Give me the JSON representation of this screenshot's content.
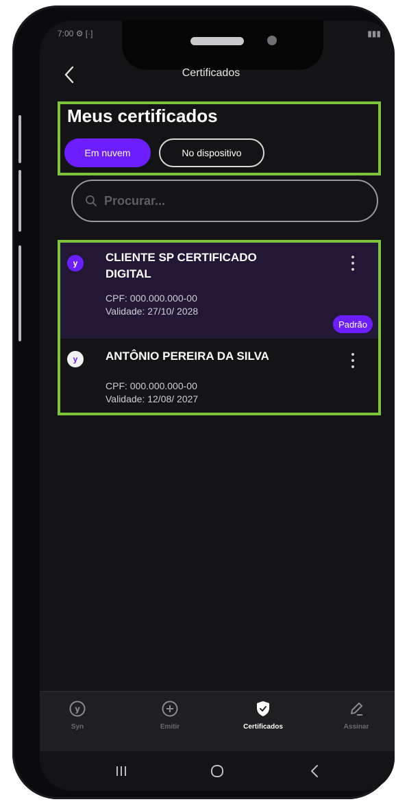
{
  "status_bar": {
    "left": "7:00 ⚙ [·]",
    "right": "▮▮▮"
  },
  "header": {
    "title": "Certificados"
  },
  "section": {
    "title": "Meus certificados",
    "chips": [
      {
        "label": "Em nuvem",
        "active": true
      },
      {
        "label": "No dispositivo",
        "active": false
      }
    ]
  },
  "search": {
    "placeholder": "Procurar..."
  },
  "certificates": [
    {
      "name": "CLIENTE SP CERTIFICADO DIGITAL",
      "cpf": "CPF: 000.000.000-00",
      "validity": "Validade: 27/10/ 2028",
      "badge": "Padrão",
      "avatar_letter": "y"
    },
    {
      "name": "ANTÔNIO PEREIRA DA SILVA",
      "cpf": "CPF: 000.000.000-00",
      "validity": "Validade: 12/08/ 2027",
      "avatar_letter": "y"
    }
  ],
  "bottom_nav": [
    {
      "label": "Syn",
      "icon": "syn-logo-icon",
      "active": false
    },
    {
      "label": "Emitir",
      "icon": "plus-circle-icon",
      "active": false
    },
    {
      "label": "Certificados",
      "icon": "shield-check-icon",
      "active": true
    },
    {
      "label": "Assinar",
      "icon": "pen-icon",
      "active": false
    }
  ],
  "colors": {
    "accent": "#6c1eff",
    "highlight": "#7cc23b",
    "background": "#141416"
  }
}
